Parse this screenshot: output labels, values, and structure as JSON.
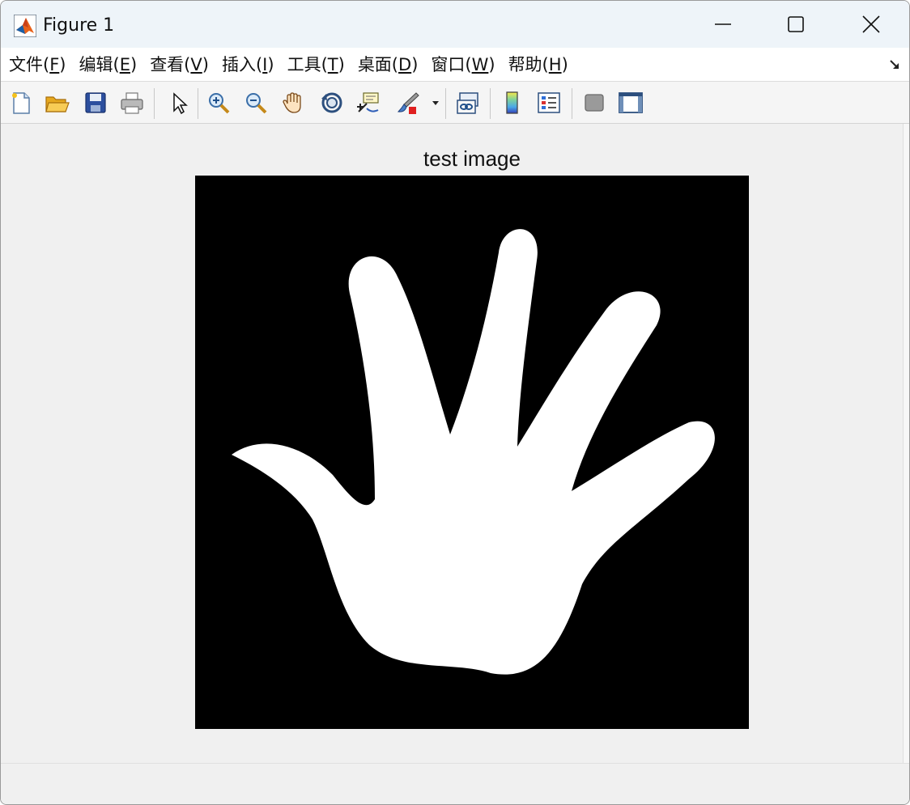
{
  "window": {
    "title": "Figure 1",
    "controls": {
      "minimize": "minimize-icon",
      "maximize": "maximize-icon",
      "close": "close-icon"
    }
  },
  "menubar": {
    "items": [
      {
        "prefix": "文件(",
        "key": "F",
        "suffix": ")"
      },
      {
        "prefix": "编辑(",
        "key": "E",
        "suffix": ")"
      },
      {
        "prefix": "查看(",
        "key": "V",
        "suffix": ")"
      },
      {
        "prefix": "插入(",
        "key": "I",
        "suffix": ")"
      },
      {
        "prefix": "工具(",
        "key": "T",
        "suffix": ")"
      },
      {
        "prefix": "桌面(",
        "key": "D",
        "suffix": ")"
      },
      {
        "prefix": "窗口(",
        "key": "W",
        "suffix": ")"
      },
      {
        "prefix": "帮助(",
        "key": "H",
        "suffix": ")"
      }
    ]
  },
  "toolbar": {
    "buttons": [
      "new-figure-icon",
      "open-file-icon",
      "save-icon",
      "print-icon",
      "edit-plot-icon",
      "zoom-in-icon",
      "zoom-out-icon",
      "pan-icon",
      "rotate-3d-icon",
      "data-cursor-icon",
      "brush-icon",
      "link-plot-icon",
      "colorbar-icon",
      "legend-icon",
      "hide-plot-tools-icon",
      "show-plot-tools-icon"
    ]
  },
  "figure": {
    "axes_title": "test image",
    "image": "white-hand-silhouette-on-black",
    "colors": {
      "background": "#000000",
      "foreground": "#ffffff"
    }
  }
}
